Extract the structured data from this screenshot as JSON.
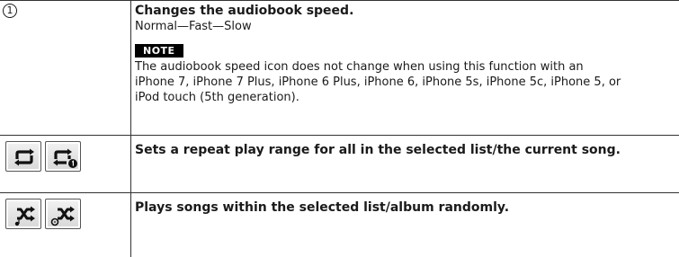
{
  "rows": [
    {
      "marker": "1",
      "title": "Changes the audiobook speed.",
      "values": "Normal—Fast—Slow",
      "note_label": "NOTE",
      "note_lines": [
        "The audiobook speed icon does not change when using this function with an",
        "iPhone 7, iPhone 7 Plus, iPhone 6 Plus, iPhone 6, iPhone 5s, iPhone 5c, iPhone 5, or",
        "iPod touch (5th generation)."
      ]
    },
    {
      "icons": [
        "repeat-all-icon",
        "repeat-one-icon"
      ],
      "title": "Sets a repeat play range for all in the selected list/the current song."
    },
    {
      "icons": [
        "shuffle-songs-icon",
        "shuffle-albums-icon"
      ],
      "title": "Plays songs within the selected list/album randomly."
    }
  ]
}
